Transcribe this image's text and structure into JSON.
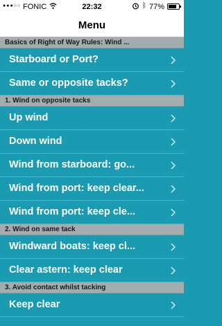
{
  "status_bar": {
    "signal": "●●●○○",
    "carrier": "FONIC",
    "time": "22:32",
    "battery_pct": "77%",
    "battery_level": 0.77,
    "icons": [
      "wifi-icon",
      "alarm-icon",
      "bluetooth-icon",
      "battery-icon"
    ]
  },
  "nav": {
    "title": "Menu"
  },
  "colors": {
    "accent": "#1a9bb1",
    "section_bg": "#a3adaf",
    "text_on_accent": "#ffffff"
  },
  "sections": [
    {
      "header": "Basics of Right of Way Rules: Wind ...",
      "items": [
        "Starboard or Port?",
        "Same or opposite tacks?"
      ]
    },
    {
      "header": "1. Wind on opposite tacks",
      "items": [
        "Up wind",
        "Down wind",
        "Wind from starboard: go...",
        "Wind from port: keep clear...",
        "Wind from port: keep cle..."
      ]
    },
    {
      "header": "2. Wind on same tack",
      "items": [
        "Windward boats: keep cl...",
        "Clear astern: keep clear"
      ]
    },
    {
      "header": "3. Avoid contact whilst tacking",
      "items": [
        "Keep clear"
      ]
    }
  ]
}
